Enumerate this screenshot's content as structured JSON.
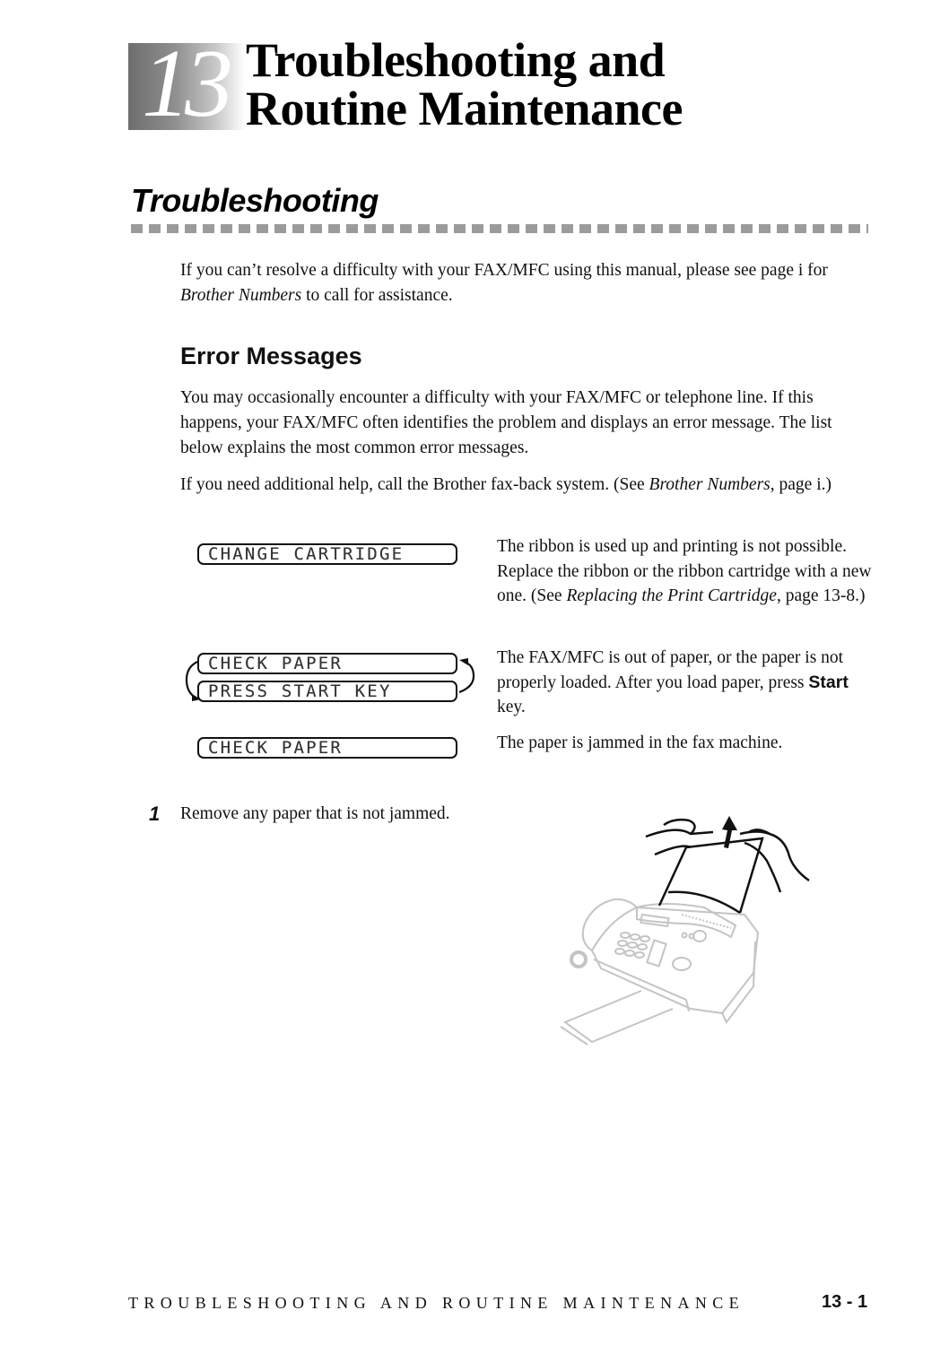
{
  "chapter": {
    "number": "13",
    "title_line1": "Troubleshooting and",
    "title_line2": "Routine Maintenance"
  },
  "section": {
    "title": "Troubleshooting",
    "intro": {
      "pre": "If you can’t resolve a difficulty with your FAX/MFC using this manual, please see page i for ",
      "italic": "Brother Numbers",
      "post": " to call for assistance."
    }
  },
  "error_messages": {
    "title": "Error Messages",
    "para1": "You may occasionally encounter a difficulty with your FAX/MFC or telephone line. If this happens, your FAX/MFC often identifies the problem and displays an error message. The list below explains the most common error messages.",
    "para2": {
      "pre": "If you need additional help, call the Brother fax-back system. (See ",
      "italic": "Brother Numbers",
      "post": ", page i.)"
    },
    "items": [
      {
        "lcd": [
          "CHANGE CARTRIDGE"
        ],
        "desc_pre": "The ribbon is used up and printing is not possible. Replace the ribbon or the ribbon cartridge with a new one. (See ",
        "desc_italic": "Replacing the Print Cartridge",
        "desc_post": ", page 13-8.)"
      },
      {
        "lcd": [
          "CHECK PAPER",
          "PRESS START KEY"
        ],
        "desc_pre": "The FAX/MFC is out of paper, or the paper is not properly loaded. After you load paper, press ",
        "desc_bold": "Start",
        "desc_post": " key."
      },
      {
        "lcd": [
          "CHECK PAPER"
        ],
        "desc_pre": "The paper is jammed in the fax machine."
      }
    ]
  },
  "steps": [
    {
      "number": "1",
      "text": "Remove any paper that is not jammed."
    }
  ],
  "figure": {
    "icon": "fax-machine-remove-paper-illustration"
  },
  "footer": {
    "title": "TROUBLESHOOTING AND ROUTINE MAINTENANCE",
    "page": "13 - 1"
  }
}
